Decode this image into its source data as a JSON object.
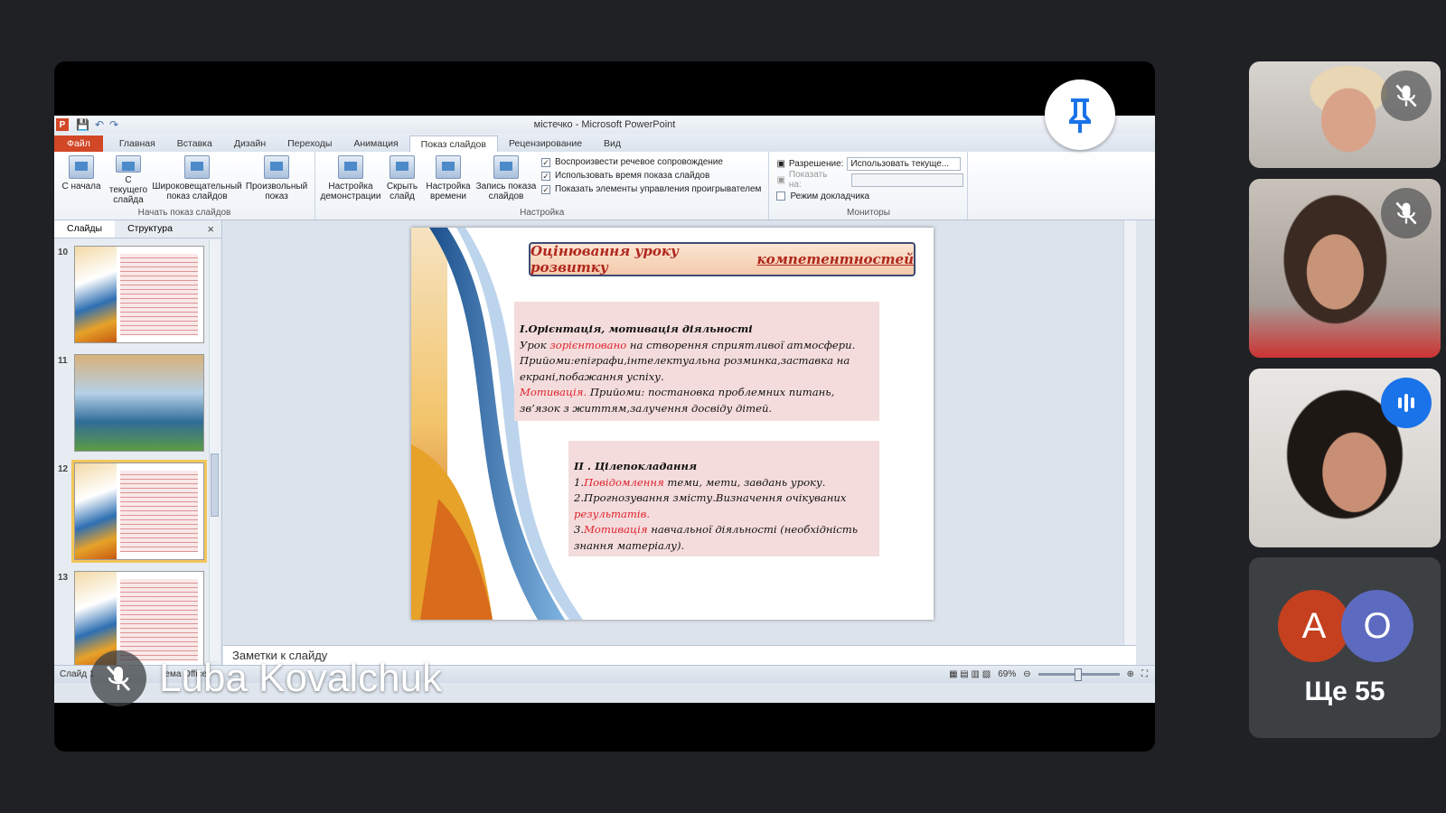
{
  "window": {
    "title": "містечко - Microsoft PowerPoint"
  },
  "ribbon": {
    "file_tab": "Файл",
    "tabs": [
      "Главная",
      "Вставка",
      "Дизайн",
      "Переходы",
      "Анимация",
      "Показ слайдов",
      "Рецензирование",
      "Вид"
    ],
    "active_tab": "Показ слайдов",
    "start_group": {
      "label": "Начать показ слайдов",
      "buttons": [
        "С начала",
        "С текущего слайда",
        "Широковещательный показ слайдов",
        "Произвольный показ"
      ]
    },
    "setup_group": {
      "label": "Настройка",
      "buttons": [
        "Настройка демонстрации",
        "Скрыть слайд",
        "Настройка времени",
        "Запись показа слайдов"
      ],
      "checks": [
        {
          "label": "Воспроизвести речевое сопровождение",
          "checked": true
        },
        {
          "label": "Использовать время показа слайдов",
          "checked": true
        },
        {
          "label": "Показать элементы управления проигрывателем",
          "checked": true
        }
      ]
    },
    "monitors_group": {
      "label": "Мониторы",
      "resolution_label": "Разрешение:",
      "resolution_value": "Использовать текуще...",
      "show_on_label": "Показать на:",
      "presenter_view_label": "Режим докладчика"
    }
  },
  "slides_panel": {
    "tabs": [
      "Слайды",
      "Структура"
    ],
    "close": "×",
    "thumbnails": [
      {
        "number": "10"
      },
      {
        "number": "11"
      },
      {
        "number": "12",
        "selected": true
      },
      {
        "number": "13"
      }
    ]
  },
  "slide": {
    "title_plain": "Оцінювання уроку розвитку",
    "title_underlined": "компетентностей",
    "box1": {
      "heading": "І.Орієнтація, мотивація діяльності",
      "l1a": "Урок ",
      "l1b": "зорієнтовано",
      "l1c": " на створення сприятливої атмосфери.",
      "l2": "Прийоми:епіграфи,інтелектуальна розминка,заставка на екрані,побажання успіху.",
      "l3a": "Мотивація.",
      "l3b": " Прийоми: постановка проблемних питань, зв’язок з життям,залучення досвіду дітей."
    },
    "box2": {
      "heading": "ІІ . Цілепокладання",
      "l1a": "1.",
      "l1b": "Повідомлення",
      "l1c": " теми, мети, завдань уроку.",
      "l2a": "2.Прогнозування змісту.Визначення очікуваних ",
      "l2b": "результатів.",
      "l3a": "3.",
      "l3b": "Мотивація",
      "l3c": " навчальної діяльності (необхідність знання матеріалу)."
    }
  },
  "notes": {
    "placeholder": "Заметки к слайду"
  },
  "statusbar": {
    "slide_info": "Слайд 1",
    "theme": "ема Office",
    "zoom": "69%"
  },
  "meeting": {
    "presenter_name": "Luba Kovalchuk",
    "avatars": [
      {
        "letter": "A",
        "color": "#c5401f"
      },
      {
        "letter": "O",
        "color": "#5c6bc0"
      }
    ],
    "more_label": "Ще 55"
  }
}
